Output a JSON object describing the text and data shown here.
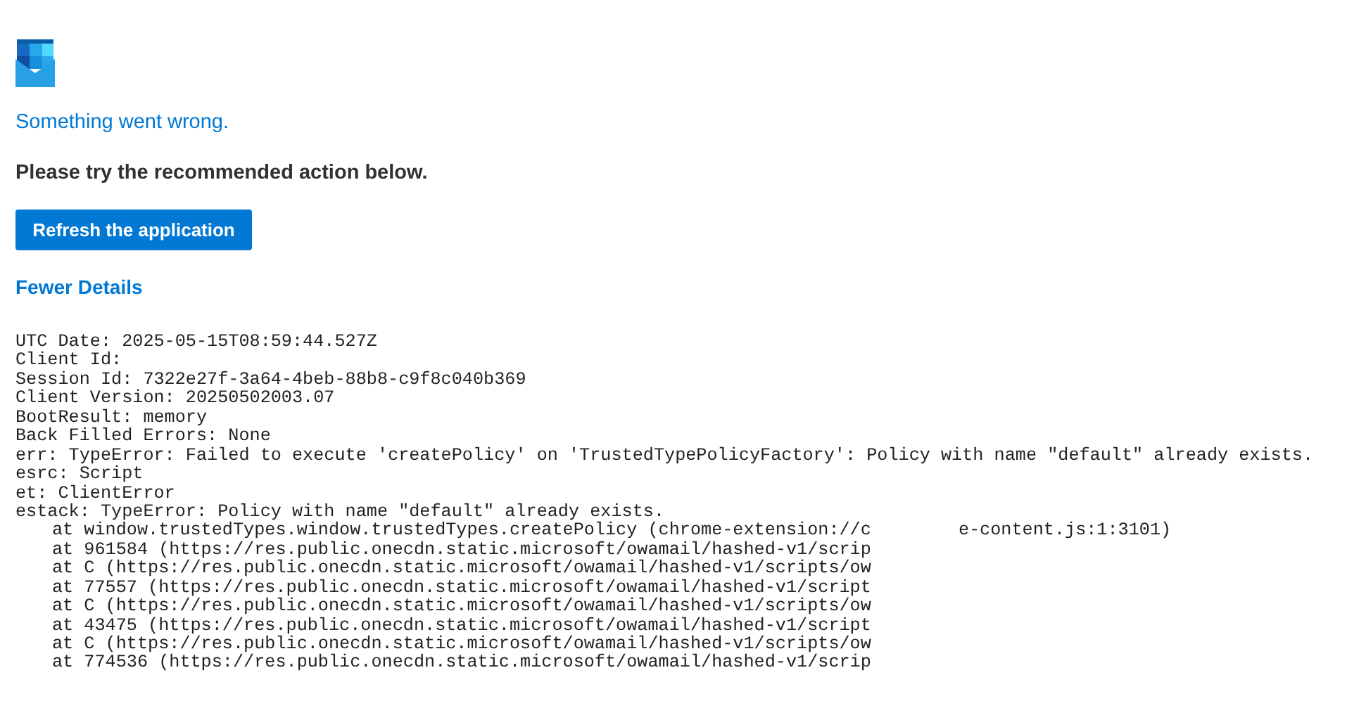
{
  "error": {
    "title": "Something went wrong.",
    "message": "Please try the recommended action below.",
    "action_button": "Refresh the application",
    "details_toggle": "Fewer Details"
  },
  "details": [
    {
      "kind": "field",
      "text": "UTC Date: 2025-05-15T08:59:44.527Z"
    },
    {
      "kind": "field",
      "text": "Client Id:"
    },
    {
      "kind": "field",
      "text": "Session Id: 7322e27f-3a64-4beb-88b8-c9f8c040b369"
    },
    {
      "kind": "field",
      "text": "Client Version: 20250502003.07"
    },
    {
      "kind": "field",
      "text": "BootResult: memory"
    },
    {
      "kind": "field",
      "text": "Back Filled Errors: None"
    },
    {
      "kind": "field",
      "text": "err: TypeError: Failed to execute 'createPolicy' on 'TrustedTypePolicyFactory': Policy with name \"default\" already exists."
    },
    {
      "kind": "field",
      "text": "esrc: Script"
    },
    {
      "kind": "field",
      "text": "et: ClientError"
    },
    {
      "kind": "field",
      "text": "estack: TypeError: Policy with name \"default\" already exists."
    },
    {
      "kind": "frame",
      "text": "at window.trustedTypes.window.trustedTypes.createPolicy (chrome-extension://c",
      "tail": "e-content.js:1:3101)"
    },
    {
      "kind": "frame",
      "text": "at 961584 (https://res.public.onecdn.static.microsoft/owamail/hashed-v1/scrip"
    },
    {
      "kind": "frame",
      "text": "at C (https://res.public.onecdn.static.microsoft/owamail/hashed-v1/scripts/ow"
    },
    {
      "kind": "frame",
      "text": "at 77557 (https://res.public.onecdn.static.microsoft/owamail/hashed-v1/script"
    },
    {
      "kind": "frame",
      "text": "at C (https://res.public.onecdn.static.microsoft/owamail/hashed-v1/scripts/ow"
    },
    {
      "kind": "frame",
      "text": "at 43475 (https://res.public.onecdn.static.microsoft/owamail/hashed-v1/script"
    },
    {
      "kind": "frame",
      "text": "at C (https://res.public.onecdn.static.microsoft/owamail/hashed-v1/scripts/ow"
    },
    {
      "kind": "frame",
      "text": "at 774536 (https://res.public.onecdn.static.microsoft/owamail/hashed-v1/scrip"
    }
  ]
}
